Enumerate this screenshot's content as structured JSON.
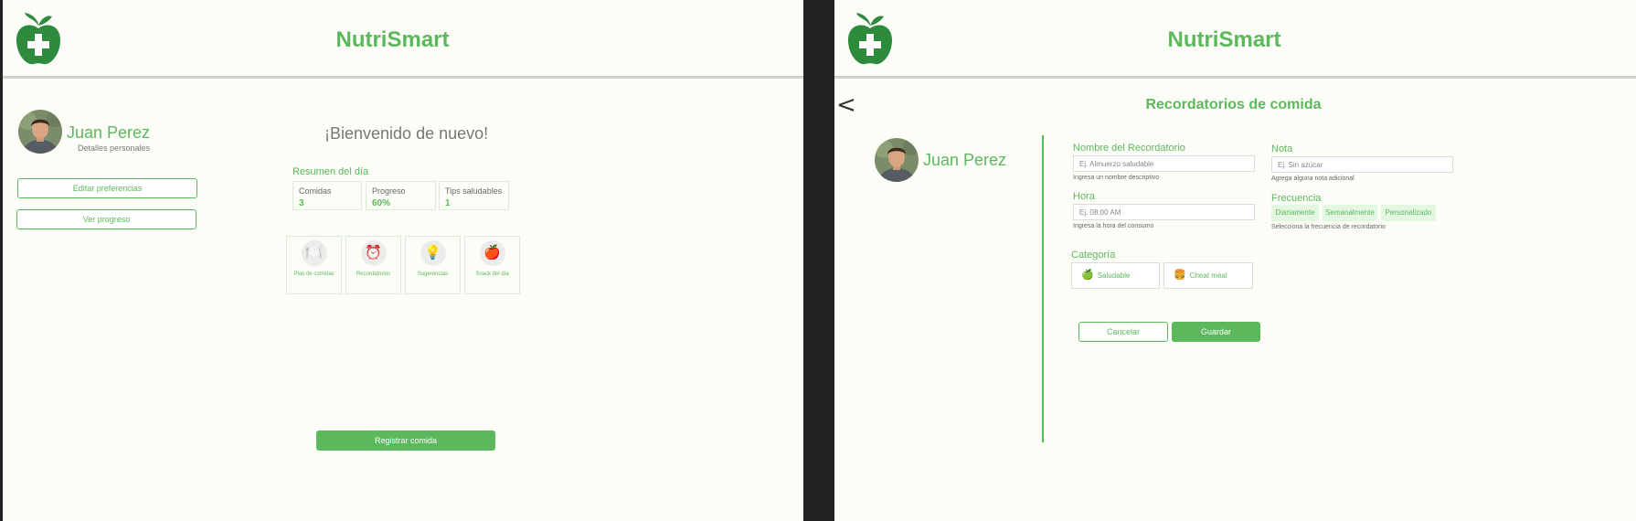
{
  "app": {
    "brand": "NutriSmart"
  },
  "user": {
    "name": "Juan Perez",
    "subtitle": "Detalles personales"
  },
  "home": {
    "edit_preferences": "Editar preferencias",
    "view_progress": "Ver progreso",
    "welcome": "¡Bienvenido de nuevo!",
    "summary_title": "Resumen del día",
    "stats": [
      {
        "label": "Comidas",
        "value": "3"
      },
      {
        "label": "Progreso",
        "value": "60%"
      },
      {
        "label": "Tips saludables",
        "value": "1"
      }
    ],
    "features": [
      {
        "icon": "🍽️",
        "icon_name": "plate-icon",
        "label": "Plan de comidas"
      },
      {
        "icon": "⏰",
        "icon_name": "alarm-clock-icon",
        "label": "Recordatorios"
      },
      {
        "icon": "💡",
        "icon_name": "lightbulb-icon",
        "label": "Sugerencias"
      },
      {
        "icon": "🍎",
        "icon_name": "apple-icon",
        "label": "Snack del día"
      }
    ],
    "register_meal": "Registrar comida"
  },
  "reminders": {
    "back": "<",
    "title": "Recordatorios de comida",
    "name_label": "Nombre del Recordatorio",
    "name_placeholder": "Ej. Almuerzo saludable",
    "name_help": "Ingresa un nombre descriptivo",
    "time_label": "Hora",
    "time_placeholder": "Ej. 08:00 AM",
    "time_help": "Ingresa la hora del consumo",
    "note_label": "Nota",
    "note_placeholder": "Ej. Sin azúcar",
    "note_help": "Agrega alguna nota adicional",
    "frequency_label": "Frecuencia",
    "frequency_options": [
      "Diariamente",
      "Semanalmente",
      "Personalizado"
    ],
    "frequency_help": "Selecciona la frecuencia de recordatorio",
    "category_label": "Categoría",
    "categories": [
      {
        "icon": "🍏",
        "icon_name": "green-apple-icon",
        "label": "Saludable"
      },
      {
        "icon": "🍔",
        "icon_name": "burger-icon",
        "label": "Cheat meal"
      }
    ],
    "cancel": "Cancelar",
    "save": "Guardar"
  },
  "colors": {
    "accent": "#5cb85c",
    "logo": "#2e8b3e",
    "background": "#fdfdf8",
    "chip_bg": "#e3f7e3"
  }
}
